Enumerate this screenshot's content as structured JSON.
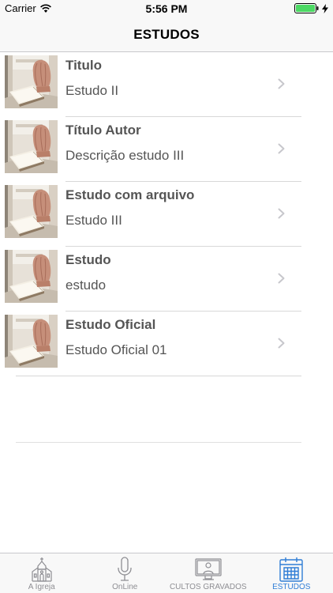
{
  "status_bar": {
    "carrier": "Carrier",
    "time": "5:56 PM"
  },
  "nav": {
    "title": "ESTUDOS"
  },
  "studies": [
    {
      "title": "Titulo",
      "description": "Estudo II"
    },
    {
      "title": "Título Autor",
      "description": "Descrição estudo III"
    },
    {
      "title": "Estudo com arquivo",
      "description": "Estudo III"
    },
    {
      "title": "Estudo",
      "description": "estudo"
    },
    {
      "title": "Estudo Oficial",
      "description": " Estudo Oficial 01"
    }
  ],
  "tabs": [
    {
      "label": "A Igreja",
      "icon": "church-icon",
      "active": false
    },
    {
      "label": "OnLine",
      "icon": "microphone-icon",
      "active": false
    },
    {
      "label": "CULTOS GRAVADOS",
      "icon": "video-screen-icon",
      "active": false
    },
    {
      "label": "ESTUDOS",
      "icon": "calendar-icon",
      "active": true
    }
  ],
  "colors": {
    "accent": "#2f7dd6",
    "battery": "#4cd964",
    "inactive_tab": "#8e8e93"
  }
}
